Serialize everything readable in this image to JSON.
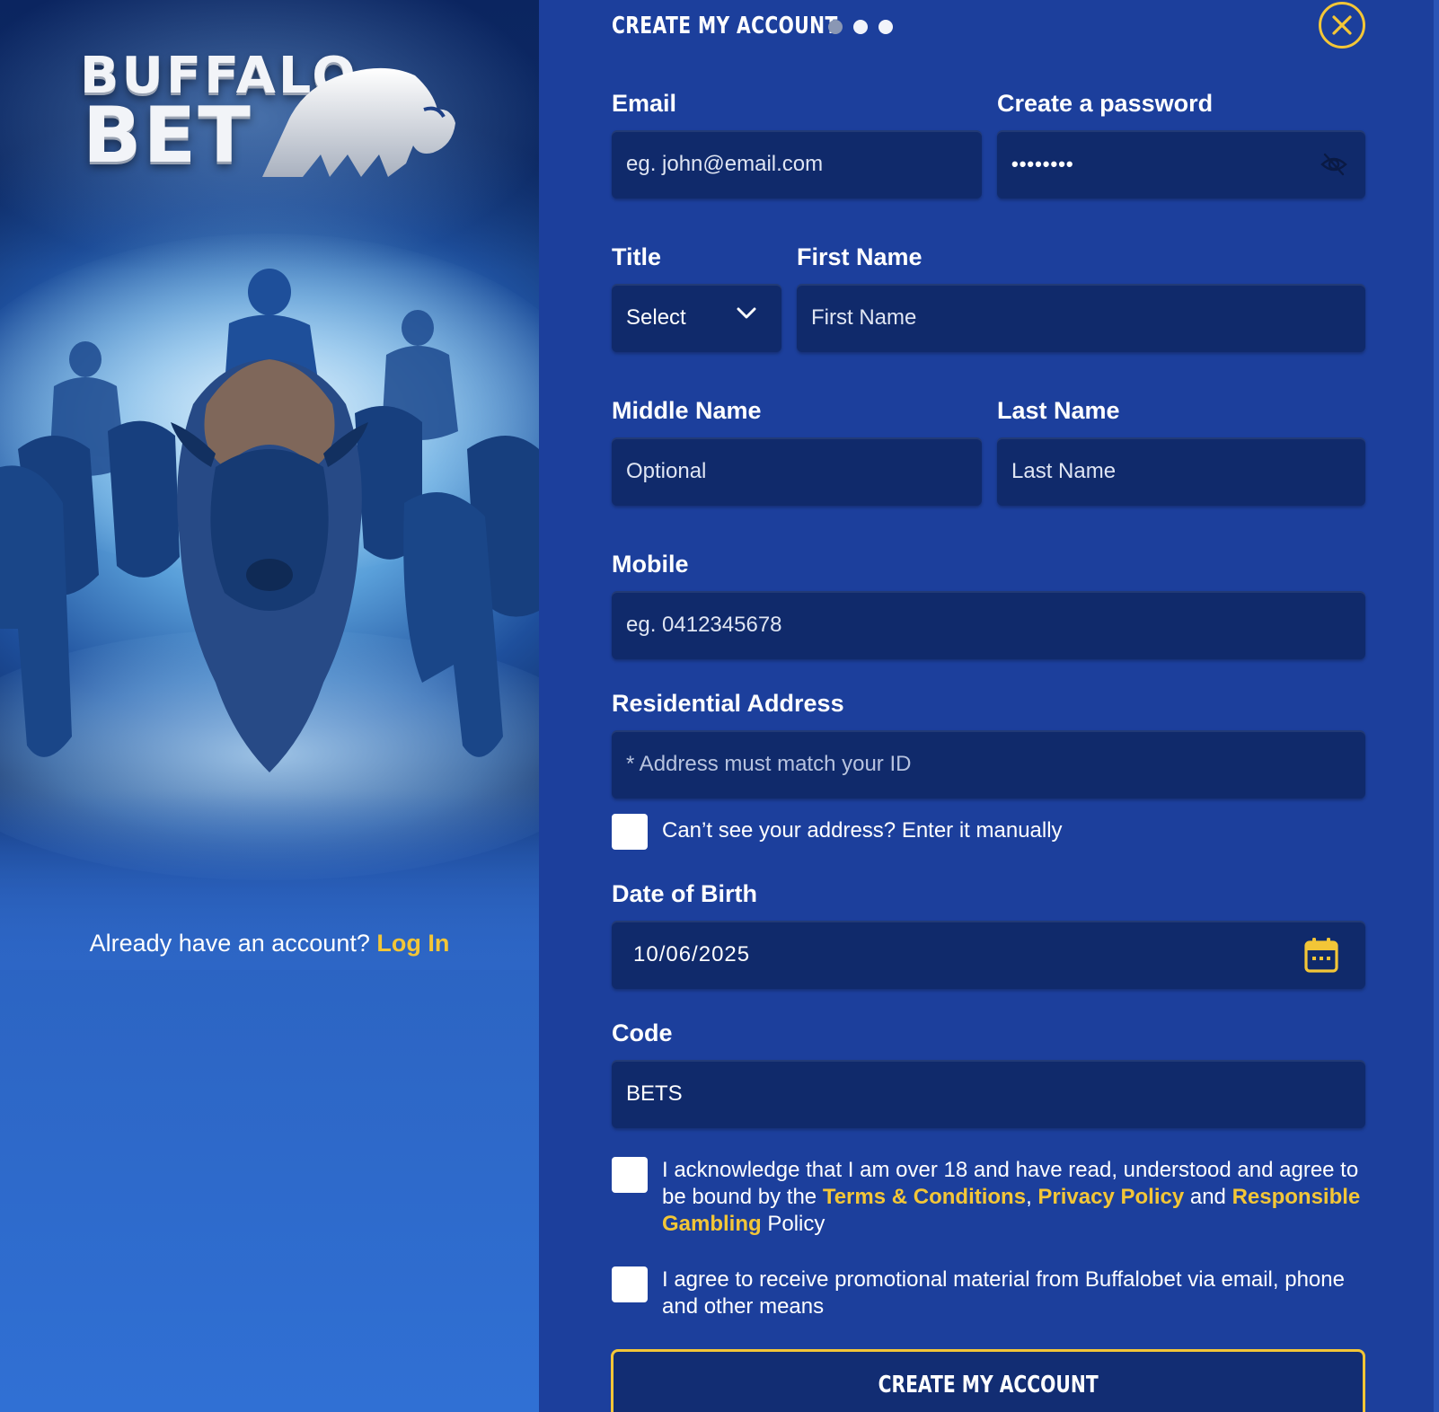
{
  "brand": {
    "line1": "BUFFALO",
    "line2": "BET"
  },
  "login": {
    "prompt": "Already have an account?",
    "link": "Log In"
  },
  "header": {
    "title": "CREATE MY ACCOUNT",
    "steps_total": 3,
    "current_step": 1
  },
  "form": {
    "email": {
      "label": "Email",
      "placeholder": "eg. john@email.com"
    },
    "password": {
      "label": "Create a password",
      "value": "••••••••"
    },
    "title": {
      "label": "Title",
      "selected": "Select"
    },
    "first_name": {
      "label": "First Name",
      "placeholder": "First Name"
    },
    "middle_name": {
      "label": "Middle Name",
      "placeholder": "Optional"
    },
    "last_name": {
      "label": "Last Name",
      "placeholder": "Last Name"
    },
    "mobile": {
      "label": "Mobile",
      "placeholder": "eg. 0412345678"
    },
    "address": {
      "label": "Residential Address",
      "placeholder": "* Address must match your ID",
      "manual_label": "Can’t see your address? Enter it manually"
    },
    "dob": {
      "label": "Date of Birth",
      "value": "10/06/2025"
    },
    "code": {
      "label": "Code",
      "value": "BETS"
    },
    "terms": {
      "pre": "I acknowledge that I am over 18 and have read, understood and agree to be bound by the ",
      "link1": "Terms & Conditions",
      "sep": ", ",
      "link2": "Privacy Policy",
      "mid": " and ",
      "link3": "Responsible Gambling",
      "post": " Policy"
    },
    "promo": {
      "text": "I agree to receive promotional material from Buffalobet via email, phone and other means"
    },
    "submit": "CREATE MY ACCOUNT"
  },
  "colors": {
    "panel": "#1c3f9c",
    "field": "#102a6b",
    "accent": "#f3c637",
    "text": "#ffffff"
  },
  "icons": [
    "close-icon",
    "eye-slash-icon",
    "chevron-down-icon",
    "calendar-icon"
  ]
}
